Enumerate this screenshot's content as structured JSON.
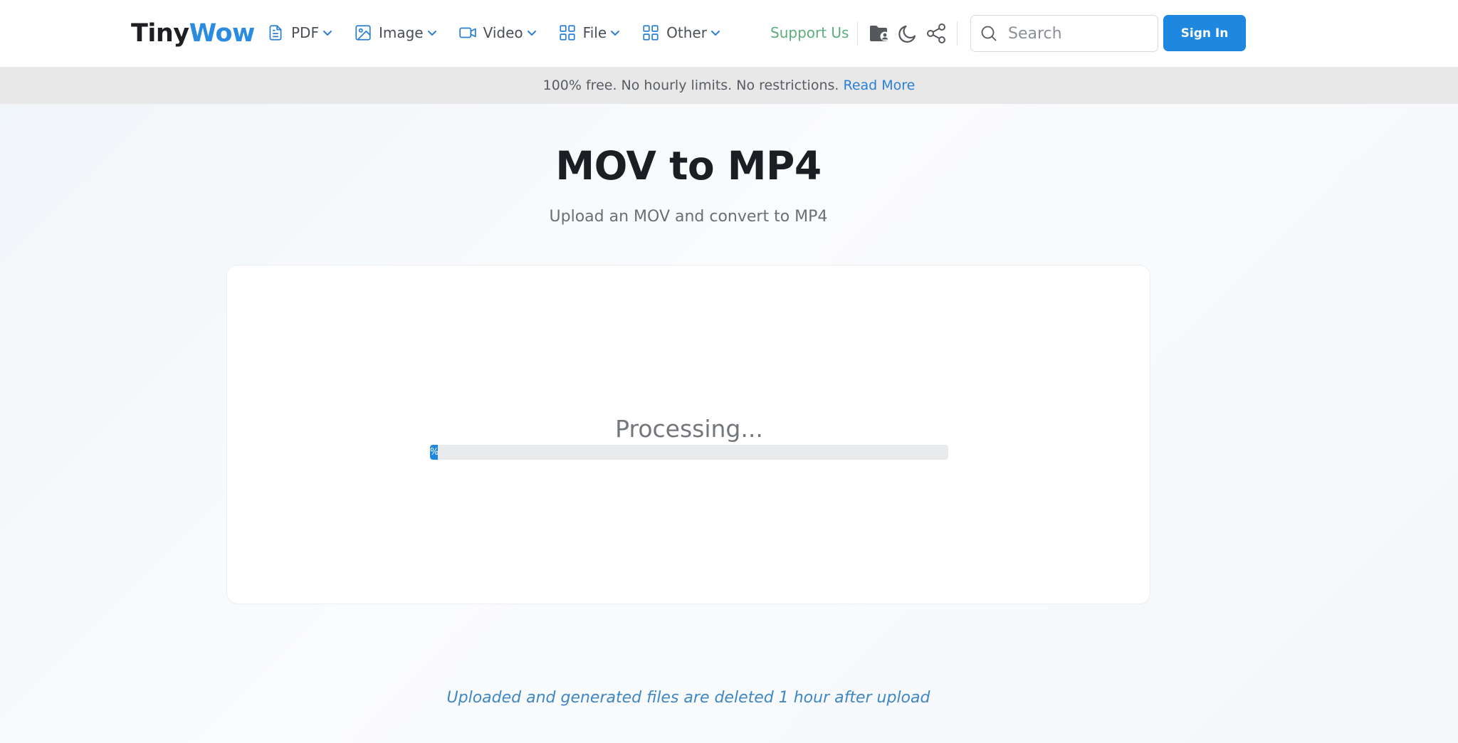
{
  "header": {
    "logo": {
      "part1": "Tiny",
      "part2": "Wow"
    },
    "nav": [
      {
        "label": "PDF",
        "icon": "document-icon"
      },
      {
        "label": "Image",
        "icon": "image-icon"
      },
      {
        "label": "Video",
        "icon": "video-camera-icon"
      },
      {
        "label": "File",
        "icon": "grid-icon"
      },
      {
        "label": "Other",
        "icon": "grid-icon"
      }
    ],
    "support_label": "Support Us",
    "search": {
      "placeholder": "Search",
      "value": ""
    },
    "signin_label": "Sign In",
    "icons": [
      "folder-user-icon",
      "moon-icon",
      "share-icon"
    ]
  },
  "notice": {
    "text": "100% free. No hourly limits. No restrictions.",
    "link": "Read More"
  },
  "main": {
    "title": "MOV to MP4",
    "subtitle": "Upload an MOV and convert to MP4",
    "status": "Processing...",
    "progress": {
      "percent": 1.5,
      "label": "%"
    },
    "footer_note": "Uploaded and generated files are deleted 1 hour after upload"
  },
  "colors": {
    "accent": "#1e87df",
    "logo_text": "#1d1f22",
    "logo_accent": "#2a8be0",
    "support": "#5aae7b",
    "notice_bg": "#e8e8e8",
    "link": "#2a7fd6",
    "footer_note": "#3e87c4"
  }
}
